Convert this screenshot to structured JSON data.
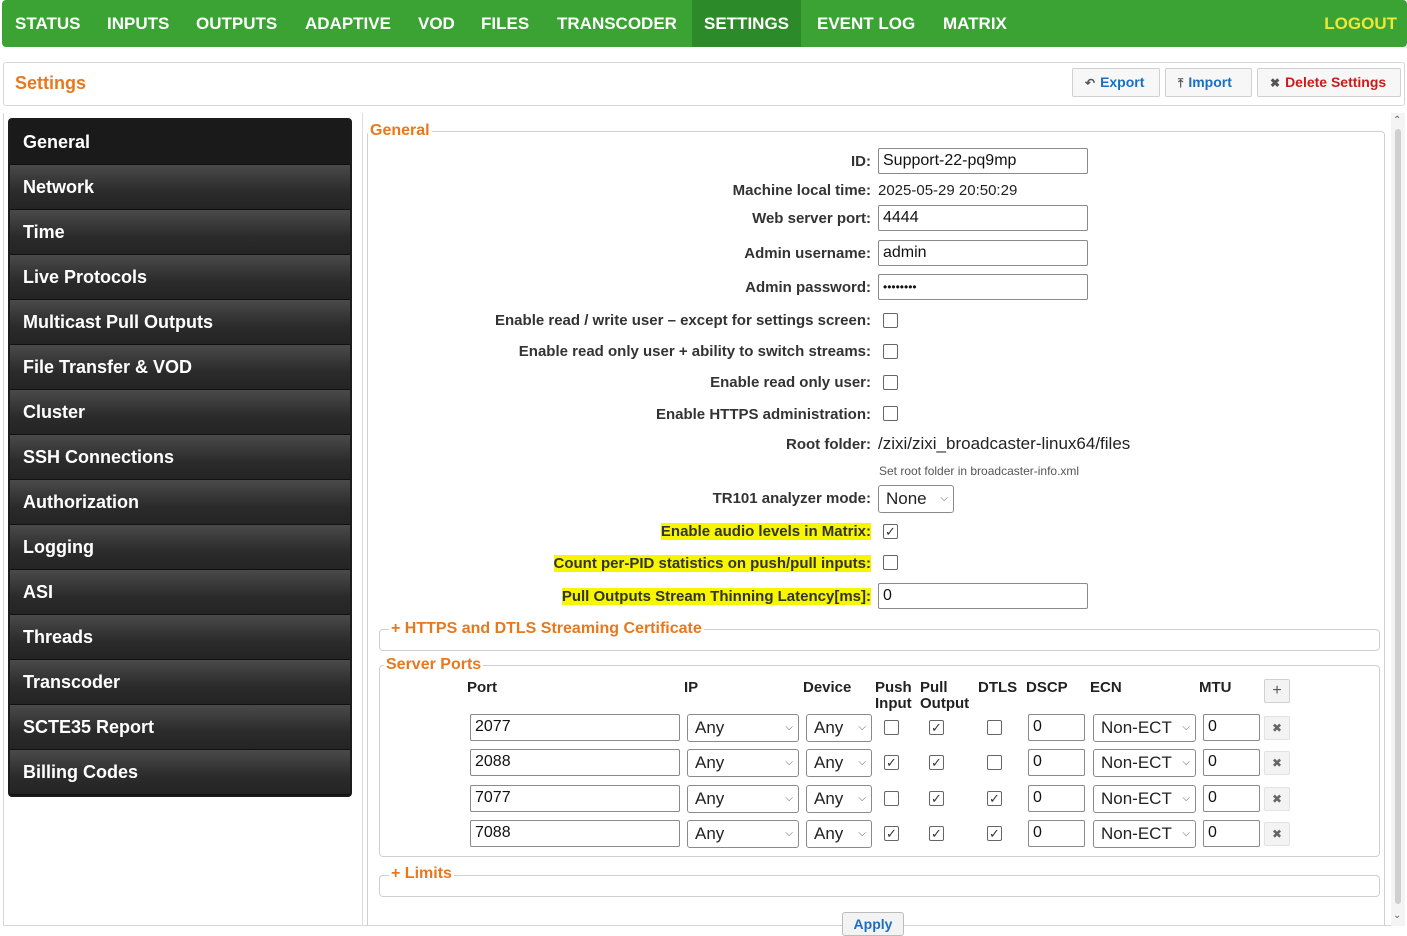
{
  "nav": {
    "items": [
      "STATUS",
      "INPUTS",
      "OUTPUTS",
      "ADAPTIVE",
      "VOD",
      "FILES",
      "TRANSCODER",
      "SETTINGS",
      "EVENT LOG",
      "MATRIX"
    ],
    "active": "SETTINGS",
    "logout": "LOGOUT"
  },
  "header": {
    "title": "Settings",
    "export": "Export",
    "import": "Import",
    "delete": "Delete Settings"
  },
  "sidebar": {
    "items": [
      "General",
      "Network",
      "Time",
      "Live Protocols",
      "Multicast Pull Outputs",
      "File Transfer & VOD",
      "Cluster",
      "SSH Connections",
      "Authorization",
      "Logging",
      "ASI",
      "Threads",
      "Transcoder",
      "SCTE35 Report",
      "Billing Codes"
    ],
    "active": "General"
  },
  "general": {
    "legend": "General",
    "id_label": "ID:",
    "id_value": "Support-22-pq9mp",
    "time_label": "Machine local time:",
    "time_value": "2025-05-29 20:50:29",
    "port_label": "Web server port:",
    "port_value": "4444",
    "admin_user_label": "Admin username:",
    "admin_user_value": "admin",
    "admin_pass_label": "Admin password:",
    "admin_pass_value": "••••••••",
    "rw_user_label": "Enable read / write user – except for settings screen:",
    "rw_user_checked": false,
    "ro_switch_label": "Enable read only user + ability to switch streams:",
    "ro_switch_checked": false,
    "ro_user_label": "Enable read only user:",
    "ro_user_checked": false,
    "https_label": "Enable HTTPS administration:",
    "https_checked": false,
    "root_label": "Root folder:",
    "root_value": "/zixi/zixi_broadcaster-linux64/files",
    "root_hint": "Set root folder in broadcaster-info.xml",
    "tr101_label": "TR101 analyzer mode:",
    "tr101_value": "None",
    "audio_label": "Enable audio levels in Matrix",
    "audio_colon": ":",
    "audio_checked": true,
    "perpid_label": "Count per-PID statistics on push/pull inputs:",
    "perpid_checked": false,
    "thinning_label": "Pull Outputs Stream Thinning Latency[ms]:",
    "thinning_value": "0"
  },
  "https_section": {
    "label": "HTTPS and DTLS Streaming Certificate",
    "icon": "plus-icon"
  },
  "server_ports": {
    "legend": "Server Ports",
    "headers": {
      "port": "Port",
      "ip": "IP",
      "device": "Device",
      "push1": "Push",
      "push2": "Input",
      "pull1": "Pull",
      "pull2": "Output",
      "dtls": "DTLS",
      "dscp": "DSCP",
      "ecn": "ECN",
      "mtu": "MTU"
    },
    "rows": [
      {
        "port": "2077",
        "ip": "Any",
        "device": "Any",
        "push": false,
        "pull": true,
        "dtls": false,
        "dscp": "0",
        "ecn": "Non-ECT",
        "mtu": "0"
      },
      {
        "port": "2088",
        "ip": "Any",
        "device": "Any",
        "push": true,
        "pull": true,
        "dtls": false,
        "dscp": "0",
        "ecn": "Non-ECT",
        "mtu": "0"
      },
      {
        "port": "7077",
        "ip": "Any",
        "device": "Any",
        "push": false,
        "pull": true,
        "dtls": true,
        "dscp": "0",
        "ecn": "Non-ECT",
        "mtu": "0"
      },
      {
        "port": "7088",
        "ip": "Any",
        "device": "Any",
        "push": true,
        "pull": true,
        "dtls": true,
        "dscp": "0",
        "ecn": "Non-ECT",
        "mtu": "0"
      }
    ]
  },
  "limits_section": {
    "label": "Limits",
    "icon": "plus-icon"
  },
  "apply": "Apply",
  "colors": {
    "nav_green": "#3aa334",
    "accent_orange": "#e8781e",
    "highlight": "#f7f500",
    "logout_yellow": "#f0e636",
    "link_blue": "#1a6fc4",
    "danger_red": "#cc1a1a"
  }
}
